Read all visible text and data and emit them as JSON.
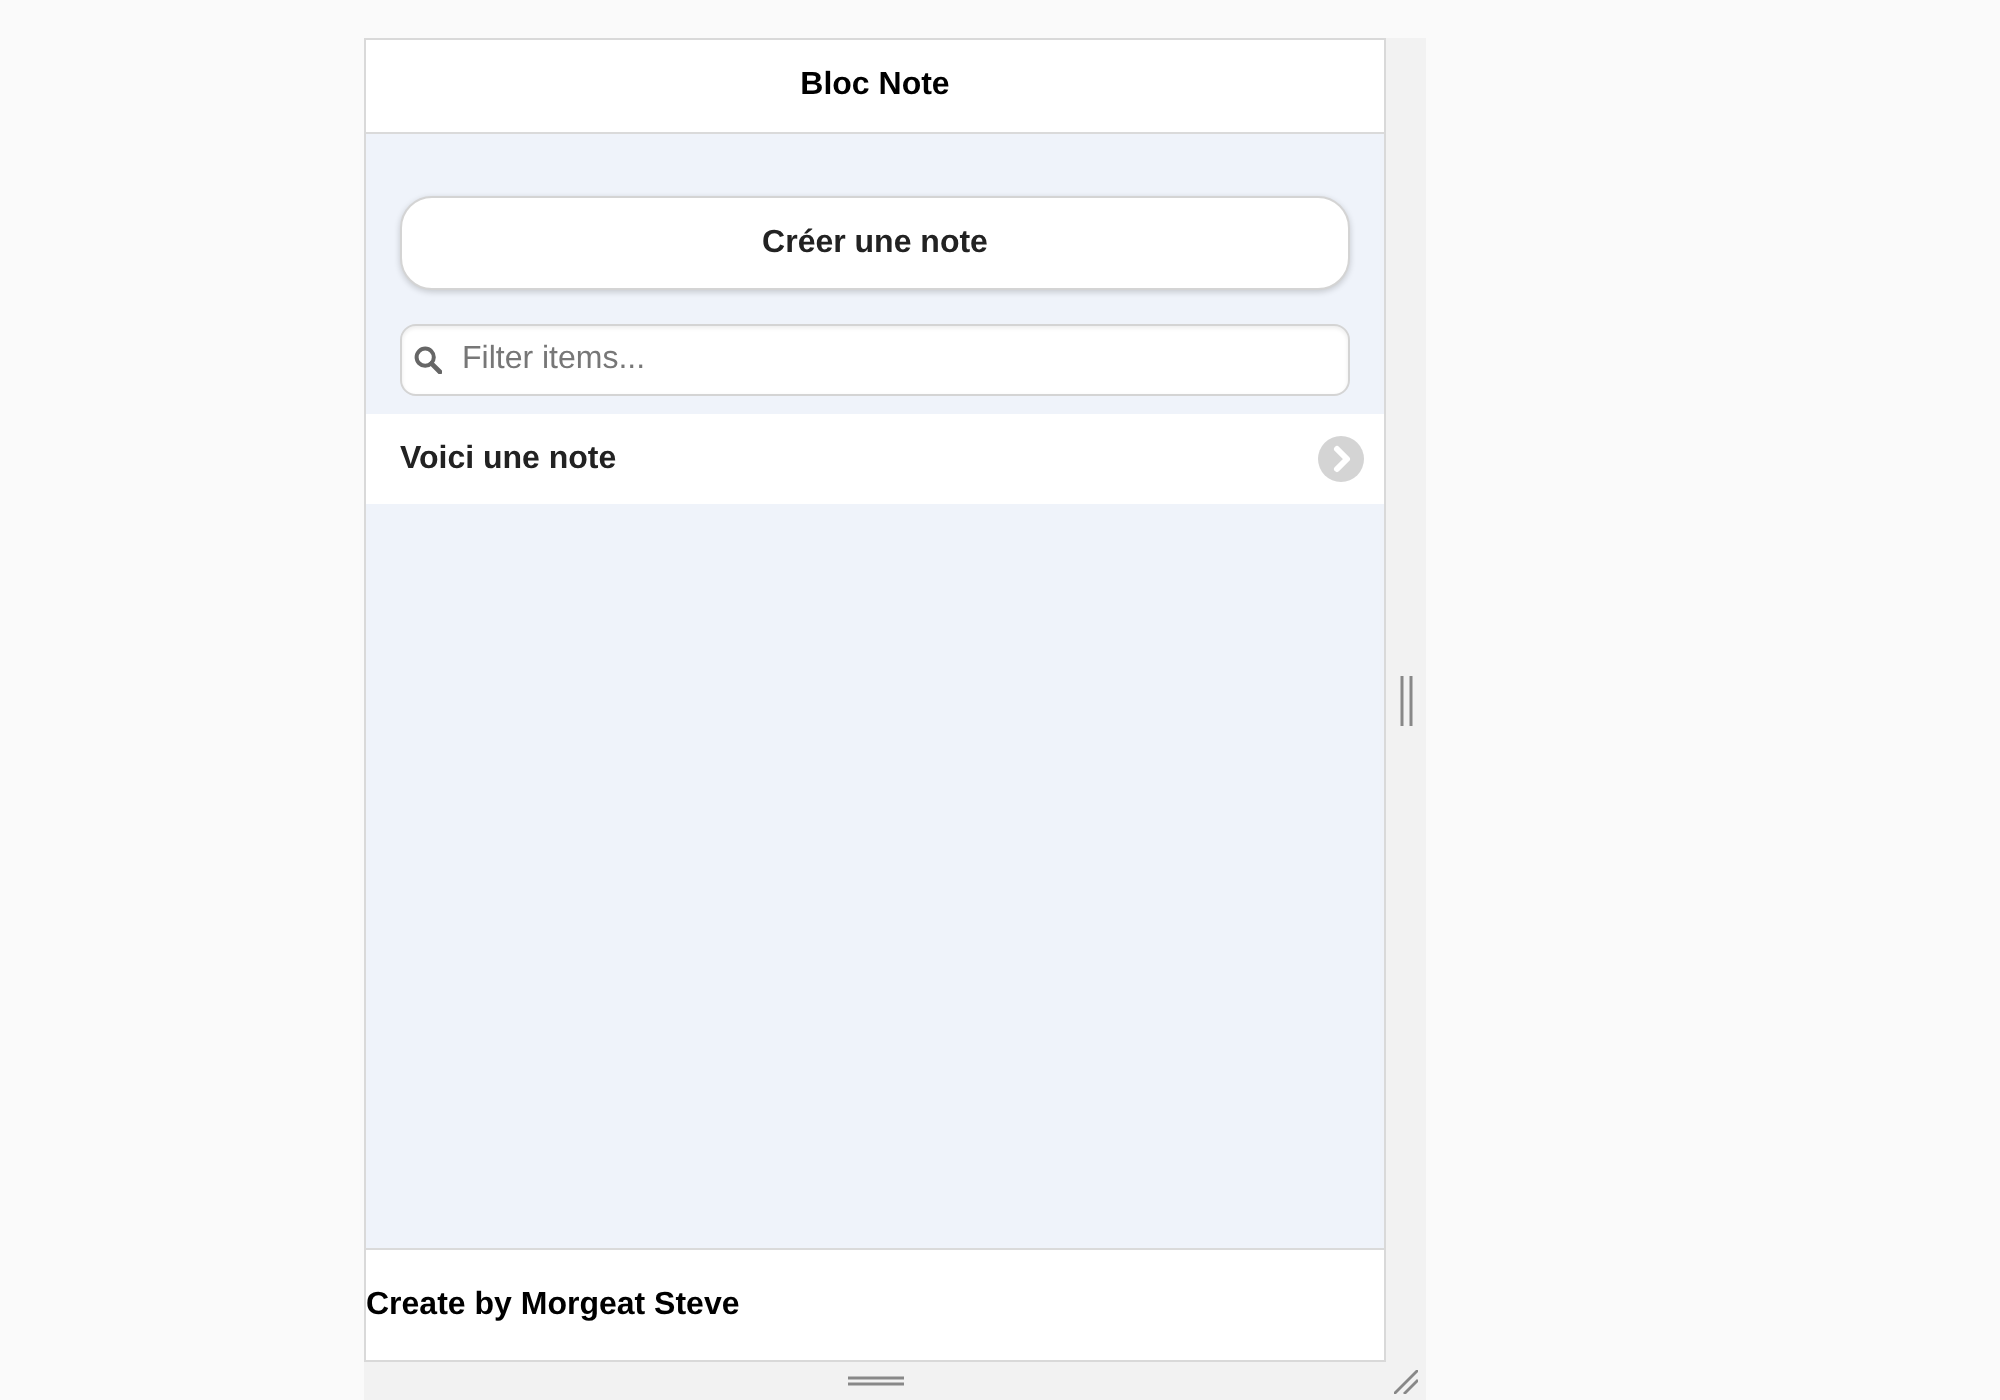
{
  "header": {
    "title": "Bloc Note"
  },
  "create_button": {
    "label": "Créer une note"
  },
  "search": {
    "placeholder": "Filter items..."
  },
  "notes": [
    {
      "title": "Voici une note"
    }
  ],
  "footer": {
    "text": "Create by Morgeat Steve"
  }
}
